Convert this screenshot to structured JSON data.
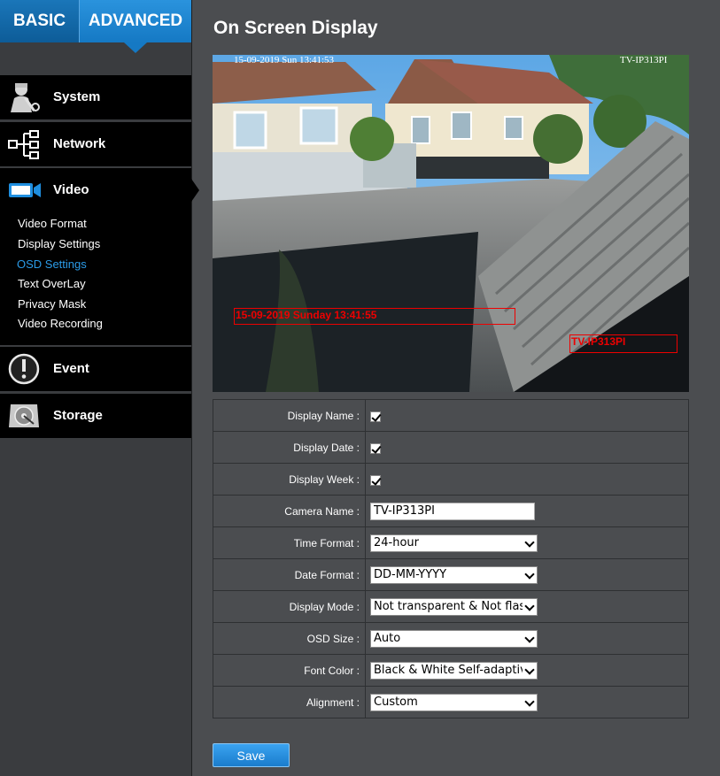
{
  "top_tabs": {
    "basic": "BASIC",
    "advanced": "ADVANCED"
  },
  "colors": {
    "accent": "#1579c4",
    "active_sub": "#2b9be8",
    "osd_red": "#e00000"
  },
  "nav": {
    "system": {
      "label": "System",
      "icon": "system-tools-icon"
    },
    "network": {
      "label": "Network",
      "icon": "network-tree-icon"
    },
    "video": {
      "label": "Video",
      "icon": "video-camera-icon",
      "sub_items": [
        "Video Format",
        "Display Settings",
        "OSD Settings",
        "Text OverLay",
        "Privacy Mask",
        "Video Recording"
      ],
      "active": "OSD Settings"
    },
    "event": {
      "label": "Event",
      "icon": "exclamation-icon"
    },
    "storage": {
      "label": "Storage",
      "icon": "storage-disk-icon"
    }
  },
  "page": {
    "title": "On Screen Display"
  },
  "preview": {
    "top_date": "15-09-2019 Sun 13:41:53",
    "top_name": "TV-IP313PI",
    "osd_date": "15-09-2019 Sunday 13:41:55",
    "osd_name": "TV-IP313PI"
  },
  "settings": {
    "display_name": {
      "label": "Display Name :",
      "checked": true
    },
    "display_date": {
      "label": "Display Date :",
      "checked": true
    },
    "display_week": {
      "label": "Display Week :",
      "checked": true
    },
    "camera_name": {
      "label": "Camera Name :",
      "value": "TV-IP313PI"
    },
    "time_format": {
      "label": "Time Format :",
      "value": "24-hour"
    },
    "date_format": {
      "label": "Date Format :",
      "value": "DD-MM-YYYY"
    },
    "display_mode": {
      "label": "Display Mode :",
      "value": "Not transparent & Not flashing"
    },
    "osd_size": {
      "label": "OSD Size :",
      "value": "Auto"
    },
    "font_color": {
      "label": "Font Color :",
      "value": "Black & White Self-adaptive"
    },
    "alignment": {
      "label": "Alignment :",
      "value": "Custom"
    }
  },
  "save_label": "Save"
}
